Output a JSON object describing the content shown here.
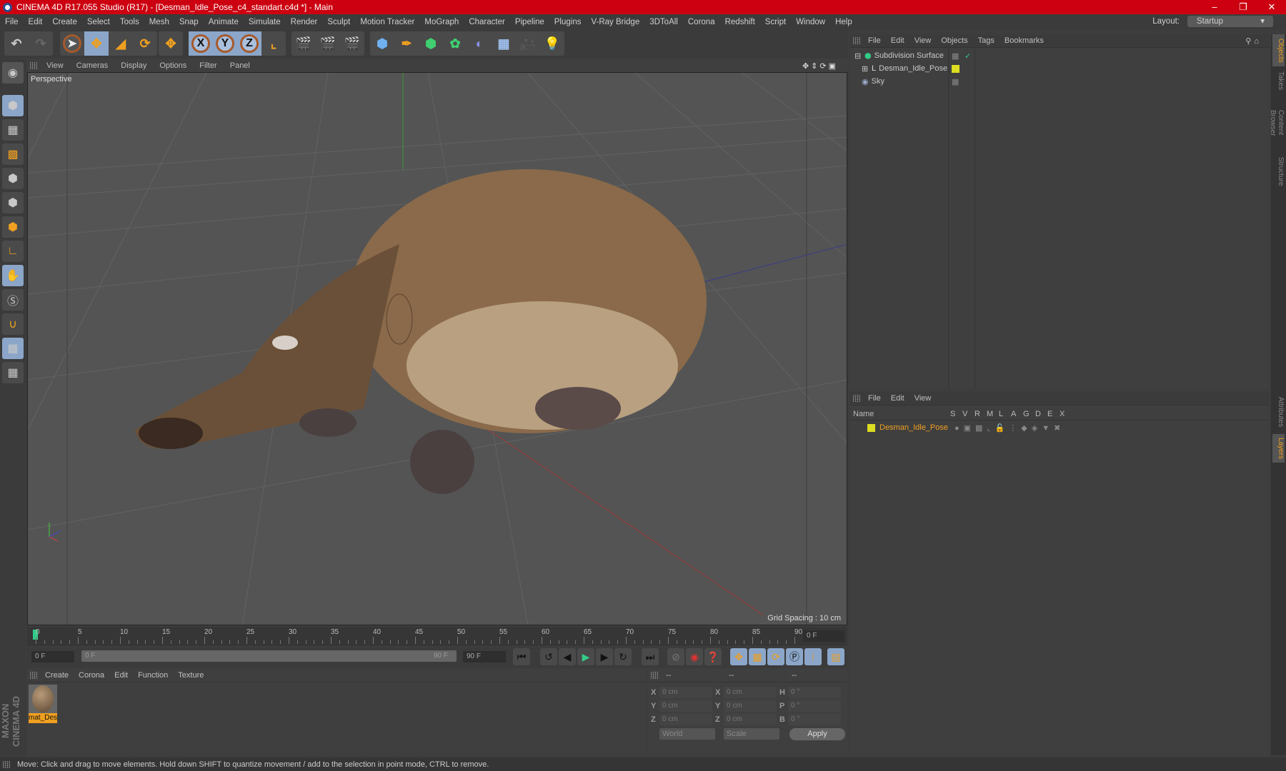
{
  "title": "CINEMA 4D R17.055 Studio (R17) - [Desman_Idle_Pose_c4_standart.c4d *] - Main",
  "menu": [
    "File",
    "Edit",
    "Create",
    "Select",
    "Tools",
    "Mesh",
    "Snap",
    "Animate",
    "Simulate",
    "Render",
    "Sculpt",
    "Motion Tracker",
    "MoGraph",
    "Character",
    "Pipeline",
    "Plugins",
    "V-Ray Bridge",
    "3DToAll",
    "Corona",
    "Redshift",
    "Script",
    "Window",
    "Help"
  ],
  "layout": {
    "label": "Layout:",
    "value": "Startup"
  },
  "viewport": {
    "menu": [
      "View",
      "Cameras",
      "Display",
      "Options",
      "Filter",
      "Panel"
    ],
    "camera": "Perspective",
    "grid_spacing": "Grid Spacing : 10 cm"
  },
  "timeline": {
    "ticks": [
      "0",
      "5",
      "10",
      "15",
      "20",
      "25",
      "30",
      "35",
      "40",
      "45",
      "50",
      "55",
      "60",
      "65",
      "70",
      "75",
      "80",
      "85",
      "90"
    ],
    "current": "0 F",
    "start": "0 F",
    "range_start": "0 F",
    "range_end": "90 F",
    "end": "90 F"
  },
  "material": {
    "menu": [
      "Create",
      "Corona",
      "Edit",
      "Function",
      "Texture"
    ],
    "items": [
      {
        "name": "mat_Des"
      }
    ]
  },
  "coords": {
    "headers": [
      "--",
      "--",
      "--"
    ],
    "rows": [
      {
        "a": "X",
        "av": "0 cm",
        "b": "X",
        "bv": "0 cm",
        "c": "H",
        "cv": "0 °"
      },
      {
        "a": "Y",
        "av": "0 cm",
        "b": "Y",
        "bv": "0 cm",
        "c": "P",
        "cv": "0 °"
      },
      {
        "a": "Z",
        "av": "0 cm",
        "b": "Z",
        "bv": "0 cm",
        "c": "B",
        "cv": "0 °"
      }
    ],
    "world": "World",
    "scale": "Scale",
    "apply": "Apply"
  },
  "objects": {
    "menu": [
      "File",
      "Edit",
      "View",
      "Objects",
      "Tags",
      "Bookmarks"
    ],
    "items": [
      {
        "name": "Subdivision Surface"
      },
      {
        "name": "Desman_Idle_Pose"
      },
      {
        "name": "Sky"
      }
    ]
  },
  "layers": {
    "menu": [
      "File",
      "Edit",
      "View"
    ],
    "columns": [
      "Name",
      "S",
      "V",
      "R",
      "M",
      "L",
      "A",
      "G",
      "D",
      "E",
      "X"
    ],
    "items": [
      {
        "name": "Desman_Idle_Pose"
      }
    ]
  },
  "right_tabs": [
    "Objects",
    "Takes",
    "Content Browser",
    "Structure",
    "Attributes",
    "Layers"
  ],
  "brand": "MAXON CINEMA 4D",
  "status": "Move: Click and drag to move elements. Hold down SHIFT to quantize movement / add to the selection in point mode, CTRL to remove."
}
